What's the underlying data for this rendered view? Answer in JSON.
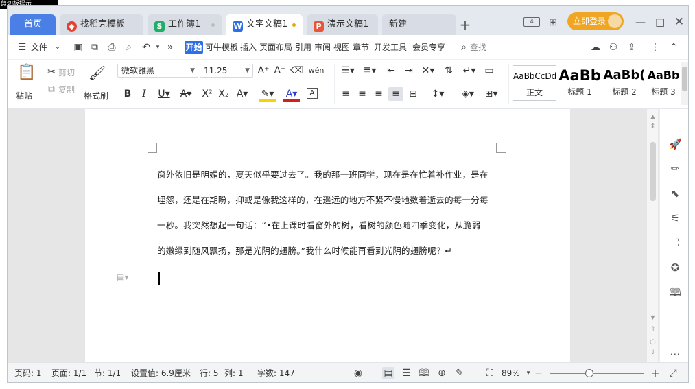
{
  "corner_tag": "剪切板提示",
  "tabs": [
    {
      "label": "首页"
    },
    {
      "label": "找稻壳模板"
    },
    {
      "label": "工作簿1"
    },
    {
      "label": "文字文稿1"
    },
    {
      "label": "演示文稿1"
    },
    {
      "label": "新建"
    }
  ],
  "tab_add": "+",
  "login_label": "立即登录",
  "menu": {
    "file": "文件",
    "more": "»",
    "items": [
      "开始",
      "可牛模板",
      "插入",
      "页面布局",
      "引用",
      "审阅",
      "视图",
      "章节",
      "开发工具",
      "会员专享"
    ],
    "search": "查找"
  },
  "ribbon": {
    "paste": "粘贴",
    "cut": "剪切",
    "copy": "复制",
    "format_painter": "格式刷",
    "font_name": "微软雅黑",
    "font_size": "11.25",
    "styles": [
      {
        "sample": "AaBbCcDd",
        "name": "正文"
      },
      {
        "sample": "AaBb",
        "name": "标题 1"
      },
      {
        "sample": "AaBb(",
        "name": "标题 2"
      },
      {
        "sample": "AaBb",
        "name": "标题 3"
      }
    ]
  },
  "document": {
    "lines": [
      "窗外依旧是明媚的，夏天似乎要过去了。我的那一班同学，现在是在忙着补作业，是在",
      "埋怨，还是在期盼，抑或是像我这样的，在遥远的地方不紧不慢地数着逝去的每一分每",
      "一秒。我突然想起一句话：“•在上课时看窗外的树，看树的颜色随四季变化，从脆弱",
      "的嫩绿到随风飘扬，那是光阴的翅膀。”我什么时候能再看到光阴的翅膀呢？↵"
    ]
  },
  "status": {
    "page_no": "页码: 1",
    "pages": "页面: 1/1",
    "section": "节: 1/1",
    "setting": "设置值: 6.9厘米",
    "row": "行: 5",
    "col": "列: 1",
    "words": "字数: 147",
    "zoom": "89%"
  }
}
